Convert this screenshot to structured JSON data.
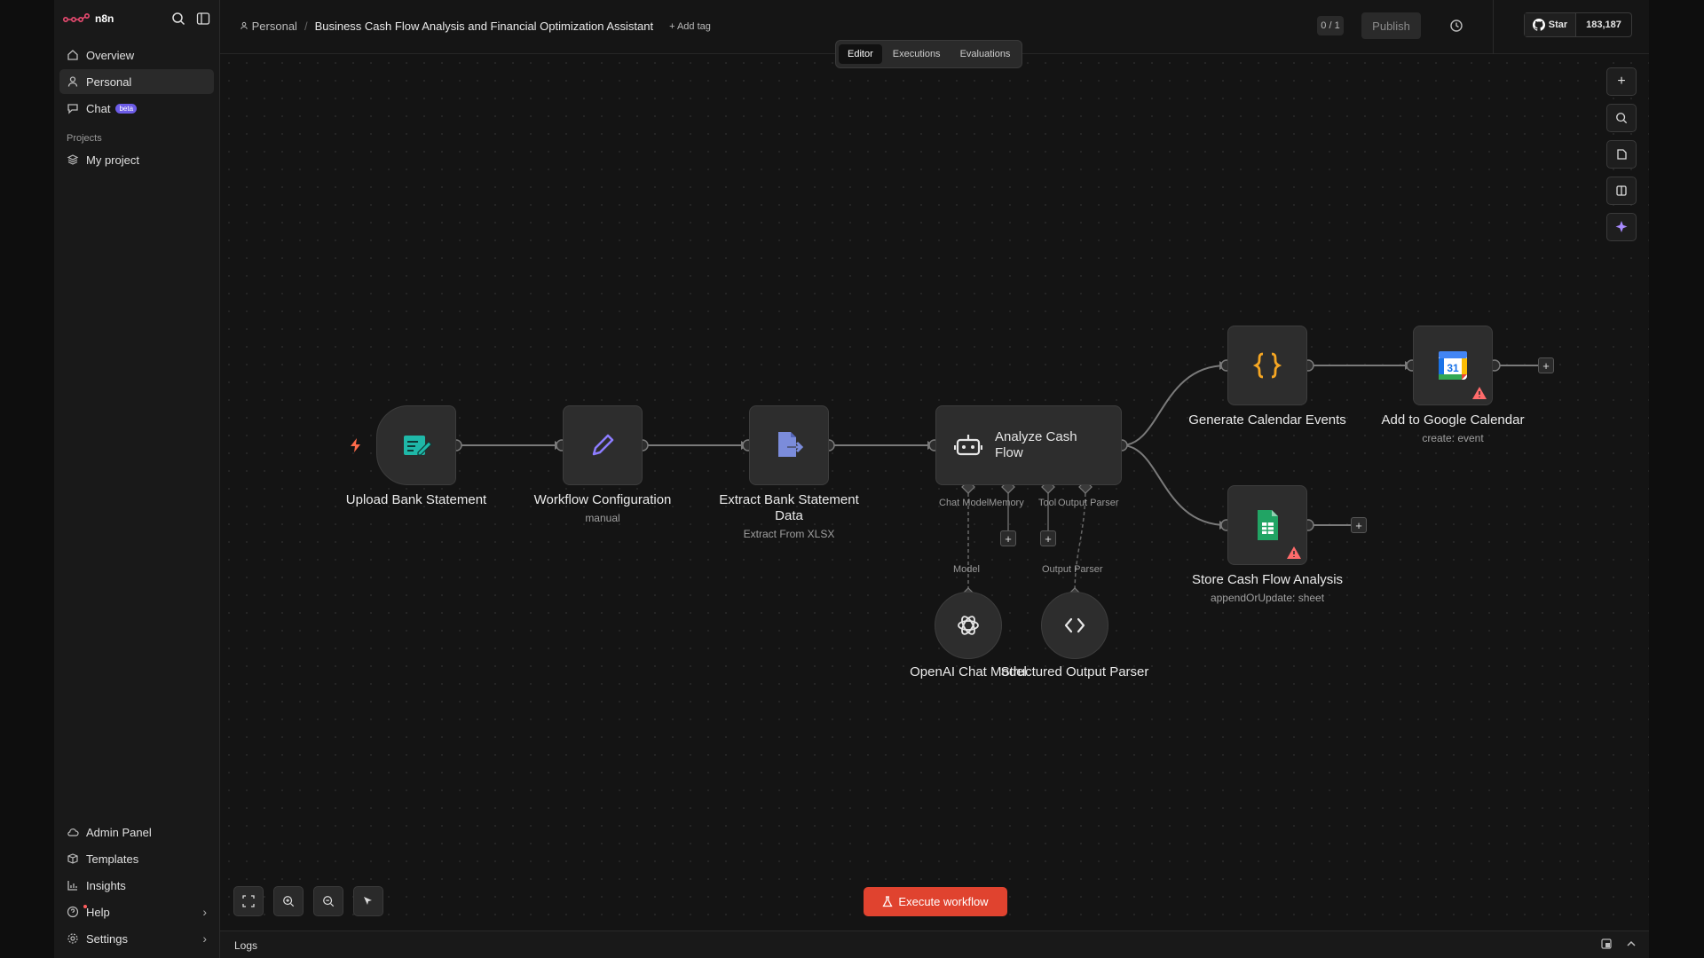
{
  "app": {
    "logo_text": "n8n"
  },
  "sidebar": {
    "nav": [
      {
        "label": "Overview",
        "icon": "home-icon"
      },
      {
        "label": "Personal",
        "icon": "user-icon"
      },
      {
        "label": "Chat",
        "icon": "chat-icon",
        "badge": "beta"
      }
    ],
    "projects_heading": "Projects",
    "projects": [
      {
        "label": "My project",
        "icon": "layers-icon"
      }
    ],
    "bottom": [
      {
        "label": "Admin Panel",
        "icon": "cloud-icon"
      },
      {
        "label": "Templates",
        "icon": "box-icon"
      },
      {
        "label": "Insights",
        "icon": "chart-icon"
      },
      {
        "label": "Help",
        "icon": "help-icon",
        "chevron": "›"
      },
      {
        "label": "Settings",
        "icon": "gear-icon",
        "chevron": "›"
      }
    ]
  },
  "header": {
    "breadcrumb_project": "Personal",
    "breadcrumb_sep": "/",
    "workflow_title": "Business Cash Flow Analysis and Financial Optimization Assistant",
    "add_tag": "+ Add tag",
    "counter": "0 / 1",
    "publish_label": "Publish",
    "github_star": "Star",
    "github_count": "183,187"
  },
  "tabs": [
    {
      "label": "Editor",
      "active": true
    },
    {
      "label": "Executions"
    },
    {
      "label": "Evaluations"
    }
  ],
  "nodes": {
    "upload": {
      "title": "Upload Bank Statement",
      "subtitle": ""
    },
    "config": {
      "title": "Workflow Configuration",
      "subtitle": "manual"
    },
    "extract": {
      "title": "Extract Bank Statement Data",
      "subtitle": "Extract From XLSX"
    },
    "analyze": {
      "title": "Analyze Cash Flow"
    },
    "generate": {
      "title": "Generate Calendar Events"
    },
    "gcal": {
      "title": "Add to Google Calendar",
      "subtitle": "create: event"
    },
    "sheets": {
      "title": "Store Cash Flow Analysis",
      "subtitle": "appendOrUpdate: sheet"
    },
    "openai": {
      "title": "OpenAI Chat Model"
    },
    "parser": {
      "title": "Structured Output Parser"
    }
  },
  "connector_labels": {
    "chat_model": "Chat Model",
    "memory": "Memory",
    "tool": "Tool",
    "output_parser": "Output Parser",
    "model": "Model",
    "output_parser_bottom": "Output Parser"
  },
  "gcal_day": "31",
  "execute_label": "Execute workflow",
  "logs_label": "Logs",
  "colors": {
    "accent": "#e0432f",
    "teal": "#1fb8a8",
    "purple": "#8d7dff",
    "slate": "#7b8cdb",
    "orange": "#f5a623",
    "sheets_green": "#21a464",
    "warn_red": "#ff6b6b"
  }
}
